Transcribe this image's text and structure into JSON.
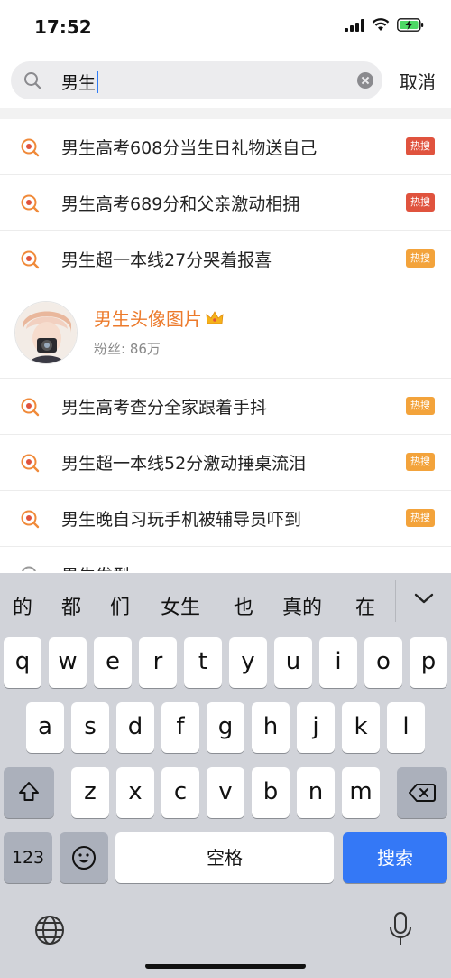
{
  "status_bar": {
    "time": "17:52",
    "icons": [
      "signal-icon",
      "wifi-icon",
      "battery-charging-icon"
    ]
  },
  "search": {
    "query": "男生",
    "cancel_label": "取消",
    "icons": [
      "search-icon",
      "clear-icon"
    ]
  },
  "suggestions": [
    {
      "text": "男生高考608分当生日礼物送自己",
      "badge": "热搜",
      "badge_color": "#e0533e"
    },
    {
      "text": "男生高考689分和父亲激动相拥",
      "badge": "热搜",
      "badge_color": "#e0533e"
    },
    {
      "text": "男生超一本线27分哭着报喜",
      "badge": "热搜",
      "badge_color": "#f3a33b"
    },
    {
      "text": "男生高考查分全家跟着手抖",
      "badge": "热搜",
      "badge_color": "#f3a33b"
    },
    {
      "text": "男生超一本线52分激动捶桌流泪",
      "badge": "热搜",
      "badge_color": "#f3a33b"
    },
    {
      "text": "男生晚自习玩手机被辅导员吓到",
      "badge": "热搜",
      "badge_color": "#f3a33b"
    },
    {
      "text": "男生发型",
      "badge": "",
      "badge_color": ""
    }
  ],
  "user_result": {
    "name": "男生头像图片",
    "fans": "粉丝: 86万",
    "icons": [
      "crown-icon",
      "avatar"
    ]
  },
  "keyboard": {
    "candidates": [
      "的",
      "都",
      "们",
      "女生",
      "也",
      "真的",
      "在"
    ],
    "row1": [
      "q",
      "w",
      "e",
      "r",
      "t",
      "y",
      "u",
      "i",
      "o",
      "p"
    ],
    "row2": [
      "a",
      "s",
      "d",
      "f",
      "g",
      "h",
      "j",
      "k",
      "l"
    ],
    "row3": [
      "z",
      "x",
      "c",
      "v",
      "b",
      "n",
      "m"
    ],
    "numbers_label": "123",
    "space_label": "空格",
    "search_label": "搜索",
    "icons": [
      "shift-icon",
      "backspace-icon",
      "emoji-icon",
      "globe-icon",
      "mic-icon",
      "chevron-down-icon"
    ],
    "accent_color": "#3478f6"
  }
}
